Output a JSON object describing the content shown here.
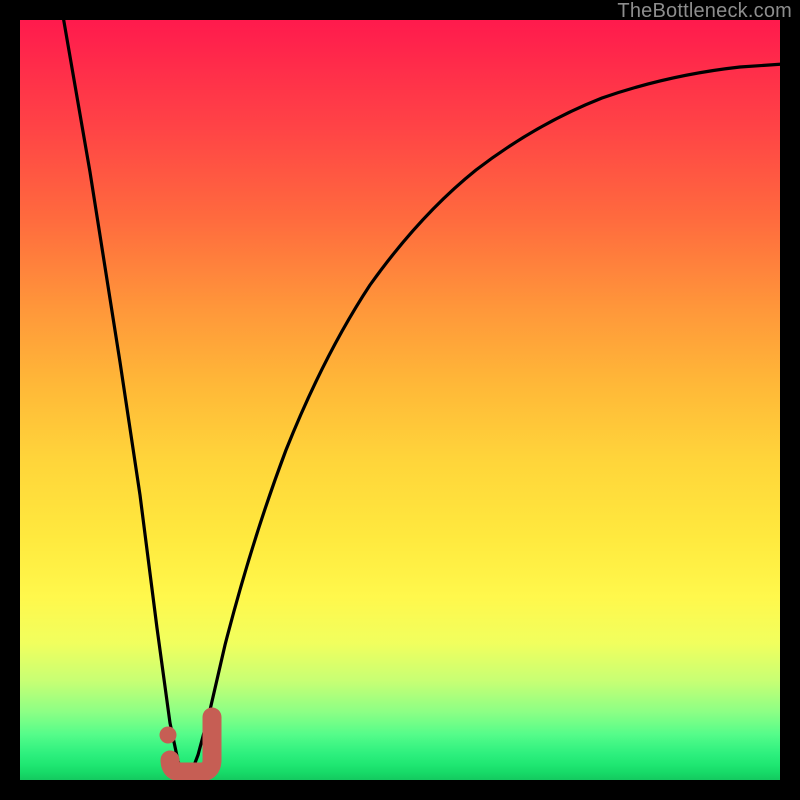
{
  "watermark": {
    "text": "TheBottleneck.com"
  },
  "colors": {
    "background": "#000000",
    "curve_stroke": "#000000",
    "marker_stroke": "#c65e54",
    "marker_fill": "#c65e54",
    "gradient_top": "#ff1a4d",
    "gradient_bottom": "#14c95f"
  },
  "chart_data": {
    "type": "line",
    "title": "",
    "xlabel": "",
    "ylabel": "",
    "xlim": [
      0,
      100
    ],
    "ylim": [
      0,
      100
    ],
    "grid": false,
    "legend": false,
    "series": [
      {
        "name": "bottleneck-curve",
        "x": [
          5,
          10,
          15,
          17.5,
          20,
          22.5,
          25,
          27.5,
          30,
          35,
          40,
          45,
          50,
          55,
          60,
          65,
          70,
          75,
          80,
          85,
          90,
          95,
          100
        ],
        "values": [
          100,
          60,
          20,
          5,
          0,
          4,
          12,
          24,
          36,
          52,
          62,
          70,
          76,
          80.5,
          84,
          86.5,
          88.5,
          90,
          91,
          91.8,
          92.4,
          92.8,
          93
        ]
      }
    ],
    "marker": {
      "name": "min-point-marker",
      "x": 20,
      "value": 0,
      "shape": "J",
      "color": "#c65e54"
    }
  }
}
